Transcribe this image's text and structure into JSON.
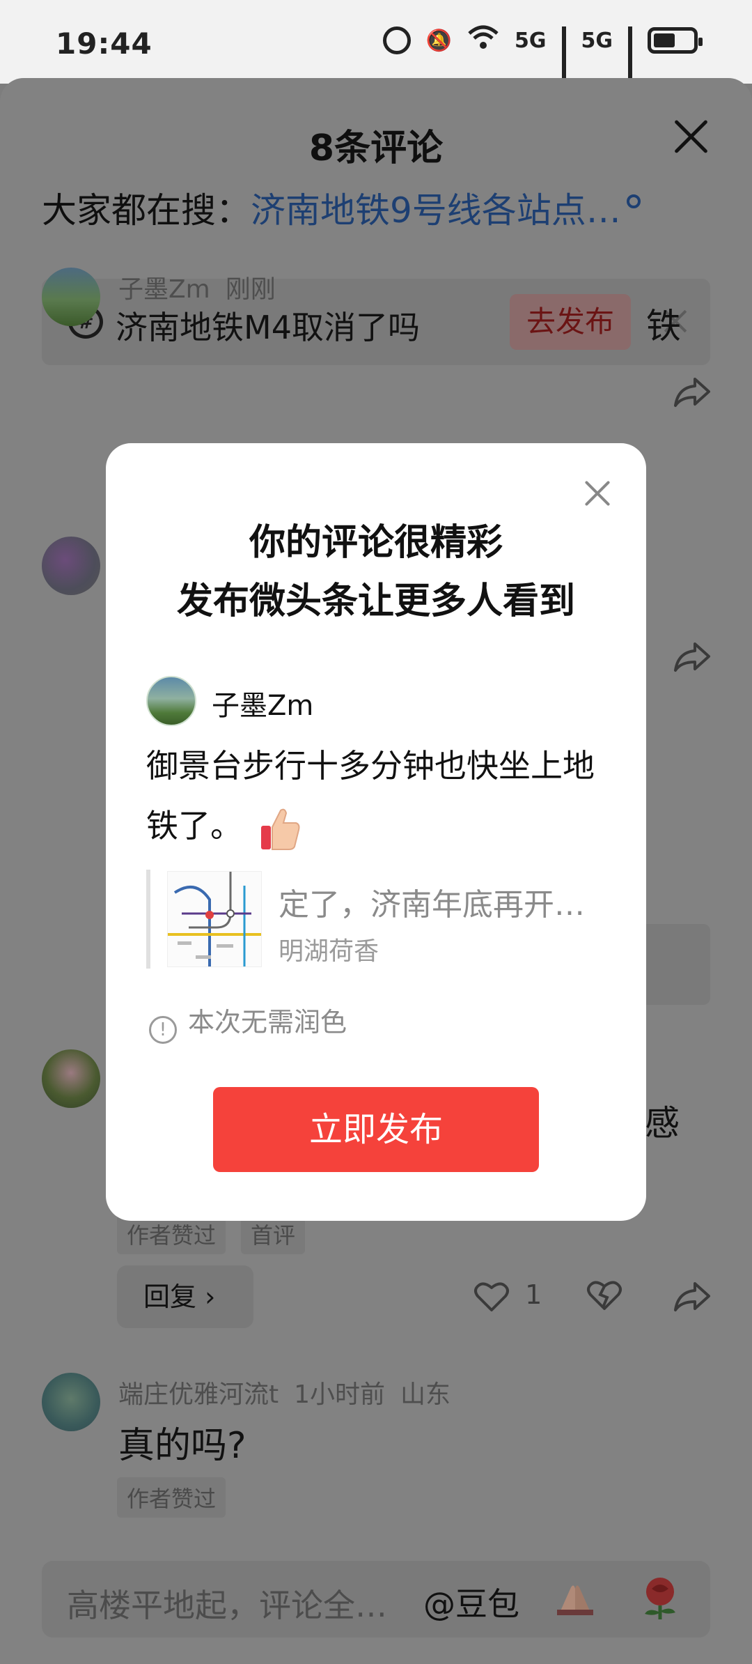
{
  "status_bar": {
    "time": "19:44",
    "net1": "5G",
    "net2": "5G"
  },
  "sheet": {
    "title": "8条评论",
    "search_prefix": "大家都在搜：",
    "search_term": "济南地铁9号线各站点…",
    "topic_label": "济南地铁M4取消了吗",
    "topic_button": "去发布"
  },
  "comments": [
    {
      "user": "子墨Zm",
      "time": "刚刚",
      "fragment": "铁"
    },
    {
      "fragment": "感",
      "tags": [
        "作者赞过",
        "首评"
      ],
      "reply_label": "回复",
      "likes": "1"
    },
    {
      "user": "端庄优雅河流t",
      "time": "1小时前",
      "location": "山东",
      "text": "真的吗?",
      "tags": [
        "作者赞过"
      ]
    }
  ],
  "bottom_input": {
    "placeholder": "高楼平地起，评论全…",
    "mention": "@豆包"
  },
  "modal": {
    "title_line1": "你的评论很精彩",
    "title_line2": "发布微头条让更多人看到",
    "username": "子墨Zm",
    "body": "御景台步行十多分钟也快坐上地铁了。",
    "quote_title": "定了，济南年底再开…",
    "quote_source": "明湖荷香",
    "hint": "本次无需润色",
    "publish_label": "立即发布"
  },
  "colors": {
    "accent_red": "#f5423b",
    "link_blue": "#1d3f72",
    "overlay": "#808080"
  },
  "icons": [
    "close-icon",
    "search-icon",
    "topic-hash-icon",
    "share-icon",
    "heart-icon",
    "broken-heart-icon",
    "info-icon",
    "thumbs-up-icon",
    "hands-icon",
    "rose-icon"
  ]
}
